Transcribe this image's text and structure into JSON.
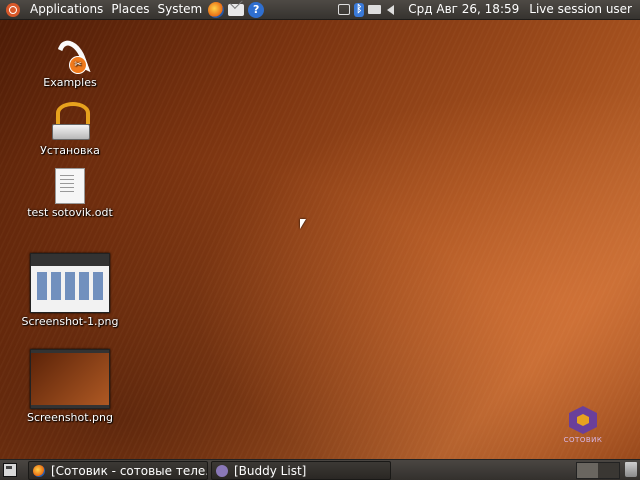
{
  "top_panel": {
    "menus": {
      "applications": "Applications",
      "places": "Places",
      "system": "System"
    },
    "launchers": {
      "help_glyph": "?"
    },
    "tray": {
      "bluetooth_glyph": "ᛒ"
    },
    "clock": "Срд Авг 26, 18:59",
    "user": "Live session user"
  },
  "desktop": {
    "icons": [
      {
        "label": "Examples"
      },
      {
        "label": "Установка"
      },
      {
        "label": "test sotovik.odt"
      },
      {
        "label": "Screenshot-1.png"
      },
      {
        "label": "Screenshot.png"
      }
    ],
    "examples_badge": "✂"
  },
  "watermark": {
    "text": "СОТОВИК"
  },
  "bottom_panel": {
    "tasks": [
      {
        "label": "[Сотовик - сотовые теле..."
      },
      {
        "label": "[Buddy List]"
      }
    ]
  },
  "colors": {
    "panel": "#3f3c38",
    "wallpaper_dark": "#4a1a06",
    "wallpaper_light": "#c06a32",
    "ubuntu_orange": "#d8582a"
  },
  "icons": {
    "ubuntu": "ubuntu-logo-icon",
    "firefox": "firefox-icon",
    "mail": "mail-icon",
    "help": "help-icon",
    "bluetooth": "bluetooth-icon",
    "volume": "volume-icon"
  }
}
